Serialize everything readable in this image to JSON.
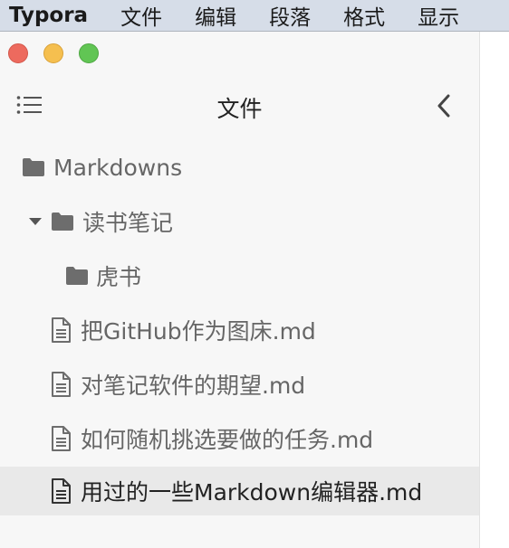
{
  "menubar": {
    "app_name": "Typora",
    "items": [
      "文件",
      "编辑",
      "段落",
      "格式",
      "显示"
    ]
  },
  "sidebar": {
    "title": "文件",
    "tree": [
      {
        "type": "folder",
        "label": "Markdowns",
        "depth": 0
      },
      {
        "type": "folder",
        "label": "读书笔记",
        "depth": 1,
        "expanded": true
      },
      {
        "type": "folder",
        "label": "虎书",
        "depth": 2
      },
      {
        "type": "file",
        "label": "把GitHub作为图床.md",
        "depth": 1
      },
      {
        "type": "file",
        "label": "对笔记软件的期望.md",
        "depth": 1
      },
      {
        "type": "file",
        "label": "如何随机挑选要做的任务.md",
        "depth": 1
      },
      {
        "type": "file",
        "label": "用过的一些Markdown编辑器.md",
        "depth": 1,
        "selected": true
      }
    ]
  },
  "colors": {
    "menubar_bg": "#d6dde8",
    "sidebar_bg": "#f7f7f7",
    "selected_row_bg": "#e9e9e9",
    "close": "#ed6a5e",
    "minimize": "#f5bf4f",
    "maximize": "#61c554",
    "icon_gray": "#6d6d6d"
  }
}
